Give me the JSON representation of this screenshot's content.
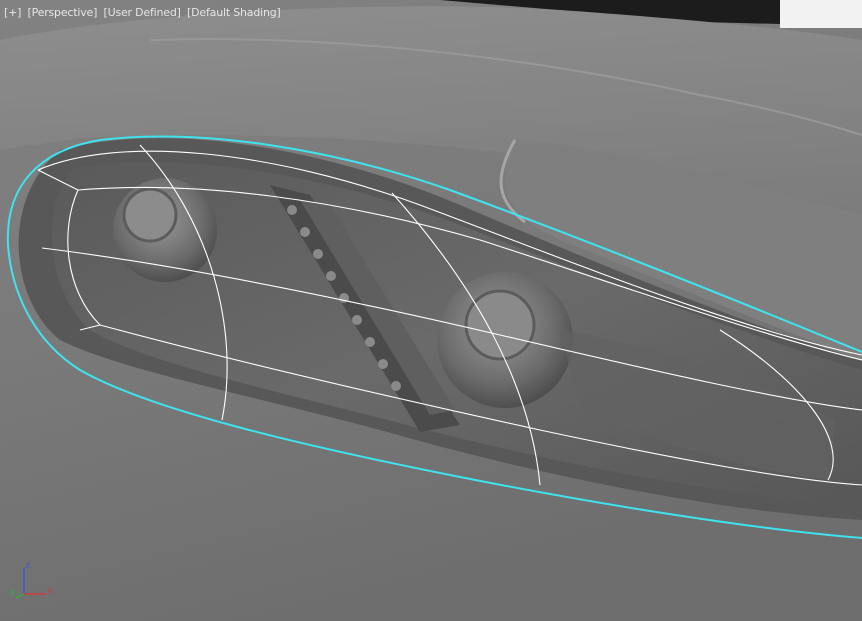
{
  "viewport": {
    "labels": {
      "plus": "[+]",
      "view": "[Perspective]",
      "camera": "[User Defined]",
      "shading": "[Default Shading]"
    },
    "colors": {
      "label_text": "#e6e6e6",
      "selection_outline": "#3fe3ee",
      "wire": "#ffffff",
      "axis_x": "#d23a3a",
      "axis_y": "#2fb53a",
      "axis_z": "#3a5bd2"
    }
  },
  "gizmo": {
    "z": "z",
    "y": "y",
    "x": "x"
  },
  "icons": [
    "axis-tripod-icon"
  ]
}
